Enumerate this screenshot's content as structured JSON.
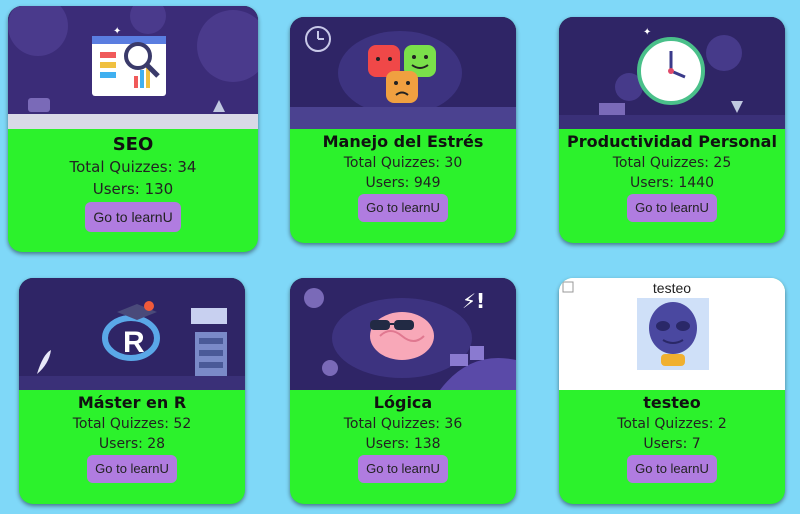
{
  "button_label": "Go to learnU",
  "courses": [
    {
      "title": "SEO",
      "quizzes": "Total Quizzes: 34",
      "users": "Users: 130"
    },
    {
      "title": "Manejo del Estrés",
      "quizzes": "Total Quizzes: 30",
      "users": "Users: 949"
    },
    {
      "title": "Productividad Personal",
      "quizzes": "Total Quizzes: 25",
      "users": "Users: 1440"
    },
    {
      "title": "Máster en R",
      "quizzes": "Total Quizzes: 52",
      "users": "Users: 28"
    },
    {
      "title": "Lógica",
      "quizzes": "Total Quizzes: 36",
      "users": "Users: 138"
    },
    {
      "title": "testeo",
      "quizzes": "Total Quizzes: 2",
      "users": "Users: 7",
      "image_alt": "testeo"
    }
  ],
  "colors": {
    "page_bg": "#7fd8f8",
    "card_bg": "#2cf22c",
    "button_bg": "#b07ce0",
    "banner_bg": "#2f2566"
  }
}
